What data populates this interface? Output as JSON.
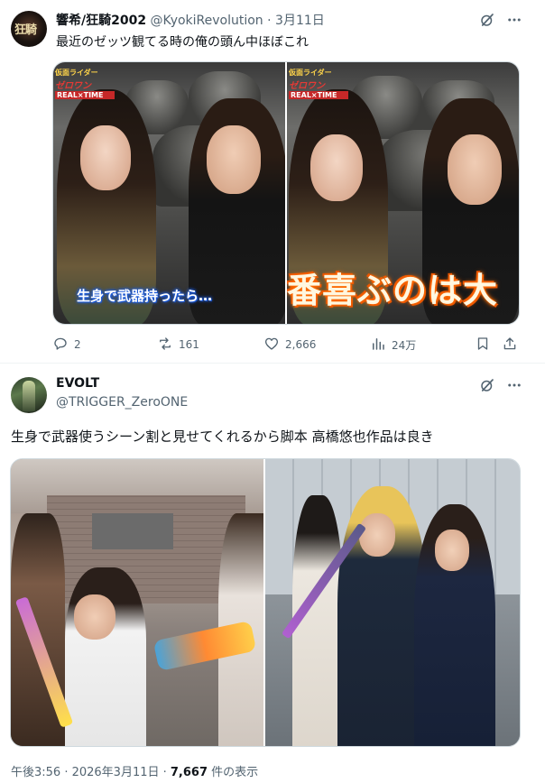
{
  "quoted_tweet": {
    "display_name": "響希/狂騎2002",
    "handle": "@KyokiRevolution",
    "separator": "·",
    "date": "3月11日",
    "text": "最近のゼッツ観てる時の俺の頭ん中ほぼこれ",
    "avatar_text": "狂騎",
    "media": {
      "left_logo": {
        "line1": "仮面ライダー",
        "line2": "ゼロワン",
        "line3": "REAL×TIME"
      },
      "right_logo": {
        "line1": "仮面ライダー",
        "line2": "ゼロワン",
        "line3": "REAL×TIME"
      },
      "left_caption": "生身で武器持ったら…",
      "right_caption": "番喜ぶのは大"
    },
    "actions": {
      "replies": "2",
      "reposts": "161",
      "likes": "2,666",
      "views": "24万"
    }
  },
  "main_tweet": {
    "display_name": "EVOLT",
    "handle": "@TRIGGER_ZeroONE",
    "text": "生身で武器使うシーン割と見せてくれるから脚本 高橋悠也作品は良き",
    "timestamp": "午後3:56 · 2026年3月11日 · ",
    "view_count": "7,667",
    "view_suffix": " 件の表示"
  },
  "colors": {
    "text_primary": "#0f1419",
    "text_secondary": "#536471",
    "divider": "#eff3f4",
    "media_border": "#cfd9de"
  },
  "icons": [
    "grok-icon",
    "more-icon",
    "reply-icon",
    "repost-icon",
    "like-icon",
    "views-icon",
    "bookmark-icon",
    "share-icon"
  ]
}
